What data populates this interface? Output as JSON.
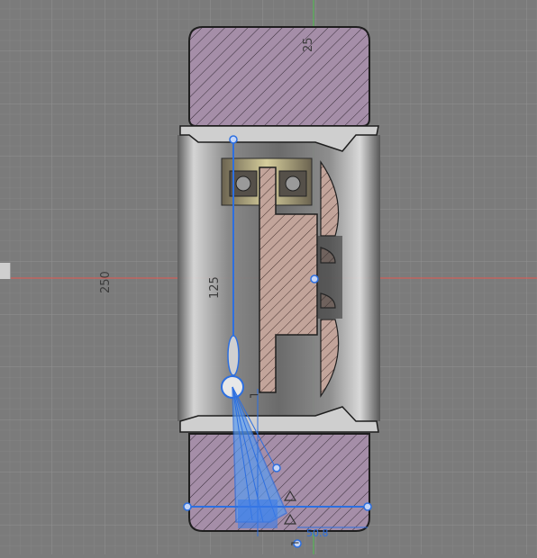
{
  "canvas": {
    "background": "#7b7b7b",
    "grid_minor": "#858585",
    "grid_major": "#8e8e8e",
    "axis_x_color": "#e4574f",
    "axis_y_color": "#4fc24f"
  },
  "dimensions": {
    "overall_height": "250",
    "inner_height": "125",
    "tire_label": "25",
    "bottom_right": "50.8"
  },
  "colors": {
    "tire_fill": "#a58ea8",
    "hub_fill": "#c2a49a",
    "rim_fill": "#d8d8d8",
    "sketch_blue": "#2d6fe0",
    "sketch_fill": "#5b9cf0"
  },
  "icons": [
    "sketch-point-icon",
    "constraint-triangle-icon",
    "edge-collapse-tab-icon"
  ]
}
